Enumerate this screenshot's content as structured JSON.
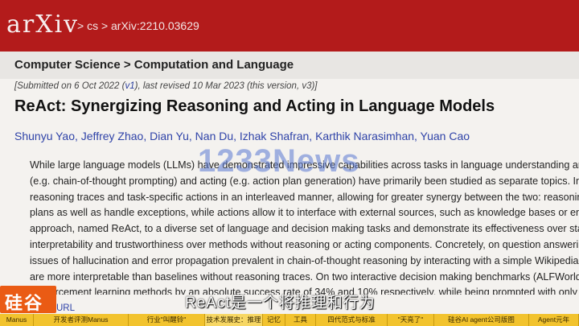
{
  "header": {
    "logo_text": "arXiv",
    "breadcrumb": "> cs > arXiv:2210.03629"
  },
  "subject": "Computer Science > Computation and Language",
  "submission": {
    "prefix": "[Submitted on 6 Oct 2022 (",
    "v1_link": "v1",
    "suffix": "), last revised 10 Mar 2023 (this version, v3)]"
  },
  "paper": {
    "title": "ReAct: Synergizing Reasoning and Acting in Language Models",
    "authors": "Shunyu Yao, Jeffrey Zhao, Dian Yu, Nan Du, Izhak Shafran, Karthik Narasimhan, Yuan Cao"
  },
  "abstract_lines": [
    "While large language models (LLMs) have demonstrated impressive capabilities across tasks in language understanding and",
    "(e.g. chain-of-thought prompting) and acting (e.g. action plan generation) have primarily been studied as separate topics. In",
    "reasoning traces and task-specific actions in an interleaved manner, allowing for greater synergy between the two: reasoning",
    "plans as well as handle exceptions, while actions allow it to interface with external sources, such as knowledge bases or env",
    "approach, named ReAct, to a diverse set of language and decision making tasks and demonstrate its effectiveness over state-of",
    "interpretability and trustworthiness over methods without reasoning or acting components. Concretely, on question answering",
    "issues of hallucination and error propagation prevalent in chain-of-thought reasoning by interacting with a simple Wikipedia A",
    "are more interpretable than baselines without reasoning traces. On two interactive decision making benchmarks (ALFWorld a",
    "reinforcement learning methods by an absolute success rate of 34% and 10% respectively, while being prompted with only one"
  ],
  "url_link": "URL",
  "watermark": "1233News",
  "channel_logo": "硅谷",
  "subtitle": "ReAct是一个将推理和行为",
  "chapters": [
    {
      "label": "Manus",
      "active": false
    },
    {
      "label": "开发者评测Manus",
      "active": false
    },
    {
      "label": "行业\"叫醒铃\"",
      "active": false
    },
    {
      "label": "技术发展史：推理",
      "active": true
    },
    {
      "label": "记忆",
      "active": false
    },
    {
      "label": "工具",
      "active": false
    },
    {
      "label": "四代范式与标准",
      "active": false
    },
    {
      "label": "\"天亮了\"",
      "active": false
    },
    {
      "label": "硅谷AI agent公司版图",
      "active": false
    },
    {
      "label": "Agent元年",
      "active": false
    }
  ]
}
